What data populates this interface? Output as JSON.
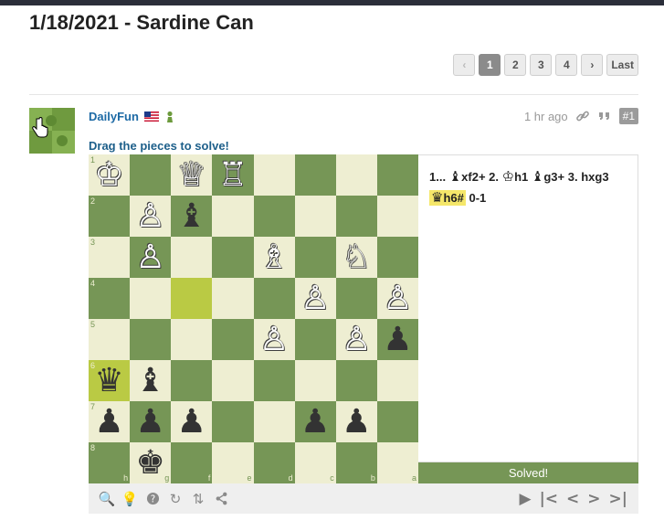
{
  "title": "1/18/2021 - Sardine Can",
  "pager": {
    "prev_icon": "chevron-left-icon",
    "pages": [
      "1",
      "2",
      "3",
      "4"
    ],
    "active": "1",
    "next_icon": "chevron-right-icon",
    "last": "Last"
  },
  "post": {
    "username": "DailyFun",
    "flag_icon": "us-flag-icon",
    "badge_icon": "pawn-badge-icon",
    "time": "1 hr ago",
    "post_number": "#1",
    "instruction": "Drag the pieces to solve!"
  },
  "board": {
    "ranks": [
      "1",
      "2",
      "3",
      "4",
      "5",
      "6",
      "7",
      "8"
    ],
    "files": [
      "h",
      "g",
      "f",
      "e",
      "d",
      "c",
      "b",
      "a"
    ],
    "pieces": [
      [
        "♔",
        "",
        "♕",
        "♖",
        "",
        "",
        "",
        ""
      ],
      [
        "",
        "♙",
        "♝",
        "",
        "",
        "",
        "",
        ""
      ],
      [
        "",
        "♙",
        "",
        "",
        "♗",
        "",
        "♘",
        ""
      ],
      [
        "",
        "",
        "",
        "",
        "",
        "♙",
        "",
        "♙"
      ],
      [
        "",
        "",
        "",
        "",
        "♙",
        "",
        "♙",
        "♟"
      ],
      [
        "♛",
        "♝",
        "",
        "",
        "",
        "",
        "",
        ""
      ],
      [
        "♟",
        "♟",
        "♟",
        "",
        "",
        "♟",
        "♟",
        ""
      ],
      [
        "",
        "♚",
        "",
        "",
        "",
        "",
        "",
        ""
      ]
    ],
    "colors": [
      [
        "w",
        "",
        "w",
        "w",
        "",
        "",
        "",
        ""
      ],
      [
        "",
        "w",
        "b",
        "",
        "",
        "",
        "",
        ""
      ],
      [
        "",
        "w",
        "",
        "",
        "w",
        "",
        "w",
        ""
      ],
      [
        "",
        "",
        "",
        "",
        "",
        "w",
        "",
        "w"
      ],
      [
        "",
        "",
        "",
        "",
        "w",
        "",
        "w",
        "b"
      ],
      [
        "b",
        "b",
        "",
        "",
        "",
        "",
        "",
        ""
      ],
      [
        "b",
        "b",
        "b",
        "",
        "",
        "b",
        "b",
        ""
      ],
      [
        "",
        "b",
        "",
        "",
        "",
        "",
        "",
        ""
      ]
    ],
    "highlights": [
      [
        3,
        2
      ],
      [
        5,
        0
      ]
    ]
  },
  "moves": {
    "m1_num": "1...",
    "m1_piece": "♝",
    "m1_text": "xf2+",
    "m2_num": "2.",
    "m2_piece": "♔",
    "m2_text": "h1",
    "m2b_piece": "♝",
    "m2b_text": "g3+",
    "m3_num": "3.",
    "m3_text": "hxg3",
    "m3b_piece": "♛",
    "m3b_text": "h6#",
    "result": "0-1"
  },
  "status": "Solved!",
  "controls": {
    "left": [
      "analyze-icon",
      "hint-icon",
      "help-icon",
      "reset-icon",
      "flip-icon",
      "share-icon"
    ],
    "right": [
      "play-icon",
      "first-move-icon",
      "prev-move-icon",
      "next-move-icon",
      "last-move-icon"
    ]
  }
}
